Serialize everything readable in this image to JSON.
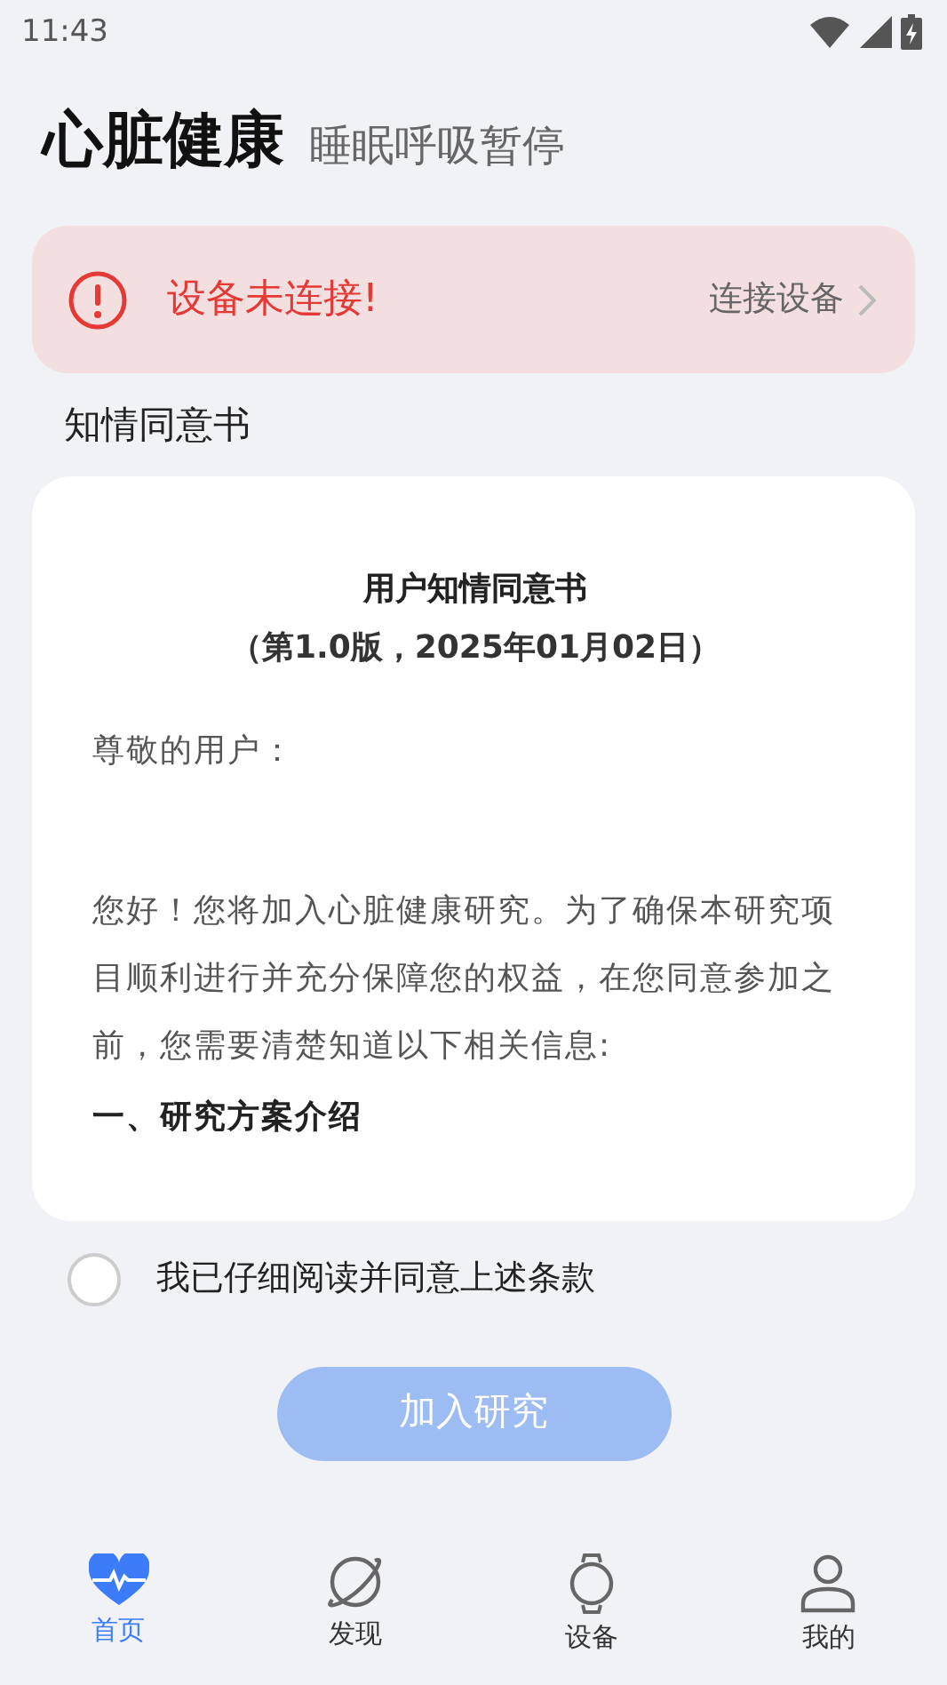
{
  "status_bar": {
    "time": "11:43"
  },
  "header": {
    "title": "心脏健康",
    "subtitle": "睡眠呼吸暂停"
  },
  "alert": {
    "message": "设备未连接!",
    "action": "连接设备"
  },
  "section_label": "知情同意书",
  "document": {
    "title": "用户知情同意书",
    "version": "（第1.0版，2025年01月02日）",
    "paragraphs": [
      {
        "kind": "text",
        "text": "尊敬的用户："
      },
      {
        "kind": "text",
        "text": "您好！您将加入心脏健康研究。为了确保本研究项目顺利进行并充分保障您的权益，在您同意参加之前，您需要清楚知道以下相关信息:"
      },
      {
        "kind": "heading",
        "text": "一、研究方案介绍"
      }
    ]
  },
  "agreement": {
    "label": "我已仔细阅读并同意上述条款",
    "checked": false
  },
  "join_button": {
    "label": "加入研究",
    "disabled": true
  },
  "tabs": [
    {
      "label": "首页",
      "kind": "heart",
      "selected": true
    },
    {
      "label": "发现",
      "kind": "planet",
      "selected": false
    },
    {
      "label": "设备",
      "kind": "watch",
      "selected": false
    },
    {
      "label": "我的",
      "kind": "person",
      "selected": false
    }
  ]
}
